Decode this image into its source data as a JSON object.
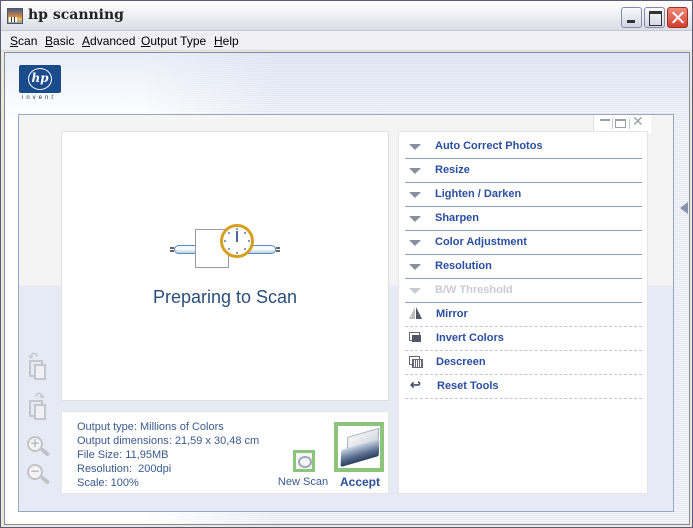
{
  "window": {
    "title": "hp scanning",
    "controls": {
      "minimize": "minimize",
      "maximize": "maximize",
      "close": "close"
    }
  },
  "menubar": {
    "items": [
      {
        "label": "Scan",
        "mnemonic": "S",
        "rest": "can"
      },
      {
        "label": "Basic",
        "mnemonic": "B",
        "rest": "asic"
      },
      {
        "label": "Advanced",
        "mnemonic": "A",
        "rest": "dvanced"
      },
      {
        "label": "Output Type",
        "mnemonic": "O",
        "rest": "utput Type"
      },
      {
        "label": "Help",
        "mnemonic": "H",
        "rest": "elp"
      }
    ]
  },
  "branding": {
    "logo_text": "hp",
    "tagline": "invent"
  },
  "preview": {
    "status": "Preparing to Scan"
  },
  "info": {
    "lines": [
      "Output type: Millions of Colors",
      "Output dimensions: 21,59 x 30,48 cm",
      "File Size: 11,95MB",
      "Resolution:  200dpi",
      "Scale: 100%"
    ]
  },
  "actions": {
    "new_scan": "New Scan",
    "accept": "Accept"
  },
  "tools": {
    "expandable": [
      {
        "label": "Auto Correct Photos",
        "enabled": true
      },
      {
        "label": "Resize",
        "enabled": true
      },
      {
        "label": "Lighten / Darken",
        "enabled": true
      },
      {
        "label": "Sharpen",
        "enabled": true
      },
      {
        "label": "Color Adjustment",
        "enabled": true
      },
      {
        "label": "Resolution",
        "enabled": true
      },
      {
        "label": "B/W Threshold",
        "enabled": false
      }
    ],
    "actions": [
      {
        "label": "Mirror",
        "icon": "mirror-icon"
      },
      {
        "label": "Invert Colors",
        "icon": "invert-colors-icon"
      },
      {
        "label": "Descreen",
        "icon": "descreen-icon"
      },
      {
        "label": "Reset Tools",
        "icon": "reset-icon"
      }
    ]
  },
  "left_toolbar": [
    {
      "name": "rotate-left",
      "icon": "rotate-left-icon"
    },
    {
      "name": "rotate-right",
      "icon": "rotate-right-icon"
    },
    {
      "name": "zoom-in",
      "icon": "zoom-in-icon"
    },
    {
      "name": "zoom-out",
      "icon": "zoom-out-icon"
    }
  ],
  "colors": {
    "accent_text": "#2a4ea0",
    "info_text": "#3a5a90",
    "highlight_border": "#8cc47c",
    "disabled_text": "#c8ccd4"
  }
}
